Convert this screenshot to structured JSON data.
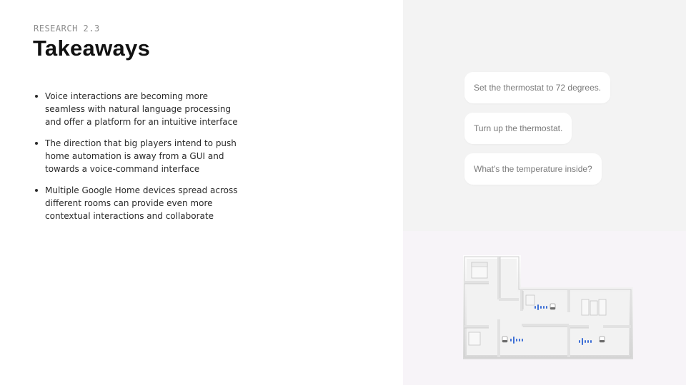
{
  "header": {
    "eyebrow": "RESEARCH 2.3",
    "title": "Takeaways"
  },
  "takeaways": [
    "Voice interactions are becoming more seamless with natural language processing and offer a platform for an intuitive interface",
    "The direction that big players intend to push home automation is away from a GUI and towards a voice-command interface",
    "Multiple Google Home devices spread across different rooms can provide even more contextual interactions and collaborate"
  ],
  "voice_commands": [
    "Set the thermostat to 72 degrees.",
    "Turn up the thermostat.",
    "What's the temperature inside?"
  ],
  "colors": {
    "panel_top": "#f3f3f3",
    "panel_bottom": "#f7f4f8",
    "voice_wave": "#3d6fd6"
  },
  "illustration": "floor-plan-with-google-home-devices"
}
